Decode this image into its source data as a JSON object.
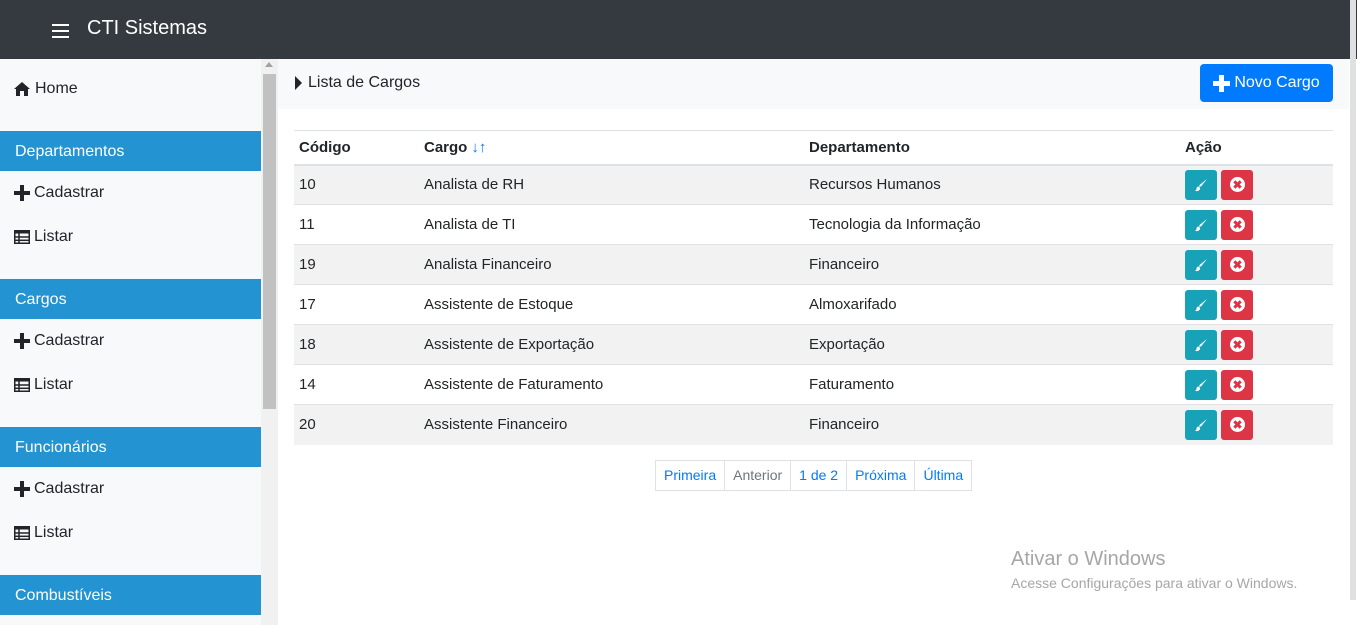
{
  "navbar": {
    "brand": "CTI Sistemas",
    "menu_icon": "hamburger-icon"
  },
  "sidebar": {
    "home_label": "Home",
    "sections": [
      {
        "title": "Departamentos",
        "items": [
          {
            "label": "Cadastrar",
            "icon": "plus-icon"
          },
          {
            "label": "Listar",
            "icon": "table-icon"
          }
        ]
      },
      {
        "title": "Cargos",
        "items": [
          {
            "label": "Cadastrar",
            "icon": "plus-icon"
          },
          {
            "label": "Listar",
            "icon": "table-icon"
          }
        ]
      },
      {
        "title": "Funcionários",
        "items": [
          {
            "label": "Cadastrar",
            "icon": "plus-icon"
          },
          {
            "label": "Listar",
            "icon": "table-icon"
          }
        ]
      },
      {
        "title": "Combustíveis",
        "items": []
      }
    ]
  },
  "main": {
    "breadcrumb": "Lista de Cargos",
    "new_button": "Novo Cargo",
    "table": {
      "headers": [
        "Código",
        "Cargo",
        "Departamento",
        "Ação"
      ],
      "rows": [
        {
          "codigo": "10",
          "cargo": "Analista de RH",
          "departamento": "Recursos Humanos"
        },
        {
          "codigo": "11",
          "cargo": "Analista de TI",
          "departamento": "Tecnologia da Informação"
        },
        {
          "codigo": "19",
          "cargo": "Analista Financeiro",
          "departamento": "Financeiro"
        },
        {
          "codigo": "17",
          "cargo": "Assistente de Estoque",
          "departamento": "Almoxarifado"
        },
        {
          "codigo": "18",
          "cargo": "Assistente de Exportação",
          "departamento": "Exportação"
        },
        {
          "codigo": "14",
          "cargo": "Assistente de Faturamento",
          "departamento": "Faturamento"
        },
        {
          "codigo": "20",
          "cargo": "Assistente Financeiro",
          "departamento": "Financeiro"
        }
      ]
    },
    "pagination": {
      "first": "Primeira",
      "prev": "Anterior",
      "current": "1 de 2",
      "next": "Próxima",
      "last": "Última"
    }
  },
  "watermark": {
    "title": "Ativar o Windows",
    "subtitle": "Acesse Configurações para ativar o Windows."
  },
  "colors": {
    "navbar": "#343a40",
    "section": "#2493d1",
    "primary": "#007bff",
    "edit": "#17a2b8",
    "delete": "#dc3545"
  }
}
